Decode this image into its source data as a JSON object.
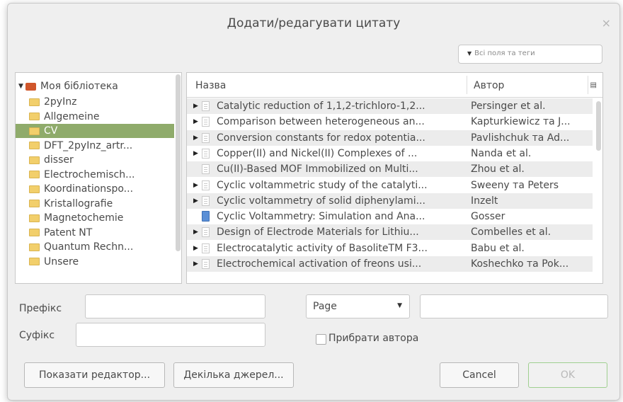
{
  "dialog": {
    "title": "Додати/редагувати цитату",
    "close_glyph": "×"
  },
  "search": {
    "label": "Всі поля та теги"
  },
  "tree": {
    "root": "Моя бібліотека",
    "items": [
      "2pyInz",
      "Allgemeine",
      "CV",
      "DFT_2pyInz_artr...",
      "disser",
      "Electrochemisch...",
      "Koordinationspo...",
      "Kristallografie",
      "Magnetochemie",
      "Patent NT",
      "Quantum Rechn...",
      "Unsere"
    ],
    "selected_index": 2
  },
  "table": {
    "columns": {
      "title": "Назва",
      "author": "Автор"
    },
    "rows": [
      {
        "title": "Catalytic reduction of 1,1,2-trichloro-1,2...",
        "author": "Persinger et al.",
        "expandable": true,
        "icon": "document-icon"
      },
      {
        "title": "Comparison between heterogeneous an...",
        "author": "Kapturkiewicz та J...",
        "expandable": true,
        "icon": "document-icon"
      },
      {
        "title": "Conversion constants for redox potentia...",
        "author": "Pavlishchuk та Ad...",
        "expandable": true,
        "icon": "document-icon"
      },
      {
        "title": "Copper(II) and Nickel(II) Complexes of ...",
        "author": "Nanda et al.",
        "expandable": true,
        "icon": "document-icon"
      },
      {
        "title": "Cu(II)-Based MOF Immobilized on Multi...",
        "author": "Zhou et al.",
        "expandable": false,
        "icon": "document-icon"
      },
      {
        "title": "Cyclic voltammetric study of the catalyti...",
        "author": "Sweeny та Peters",
        "expandable": true,
        "icon": "document-icon"
      },
      {
        "title": "Cyclic voltammetry of solid diphenylami...",
        "author": "Inzelt",
        "expandable": true,
        "icon": "document-icon"
      },
      {
        "title": "Cyclic Voltammetry: Simulation and Ana...",
        "author": "Gosser",
        "expandable": false,
        "icon": "book-icon"
      },
      {
        "title": "Design of Electrode Materials for Lithiu...",
        "author": "Combelles et al.",
        "expandable": true,
        "icon": "document-icon"
      },
      {
        "title": "Electrocatalytic activity of BasoliteTM F3...",
        "author": "Babu et al.",
        "expandable": true,
        "icon": "document-icon"
      },
      {
        "title": "Electrochemical activation of freons usi...",
        "author": "Koshechko та Pok...",
        "expandable": true,
        "icon": "document-icon"
      }
    ]
  },
  "form": {
    "prefix_label": "Префікс",
    "prefix_value": "",
    "suffix_label": "Суфікс",
    "suffix_value": "",
    "locator_select": "Page",
    "locator_value": "",
    "suppress_author_label": "Прибрати автора",
    "suppress_author_checked": false
  },
  "buttons": {
    "show_editor": "Показати редактор...",
    "multiple_sources": "Декілька джерел...",
    "cancel": "Cancel",
    "ok": "OK"
  }
}
